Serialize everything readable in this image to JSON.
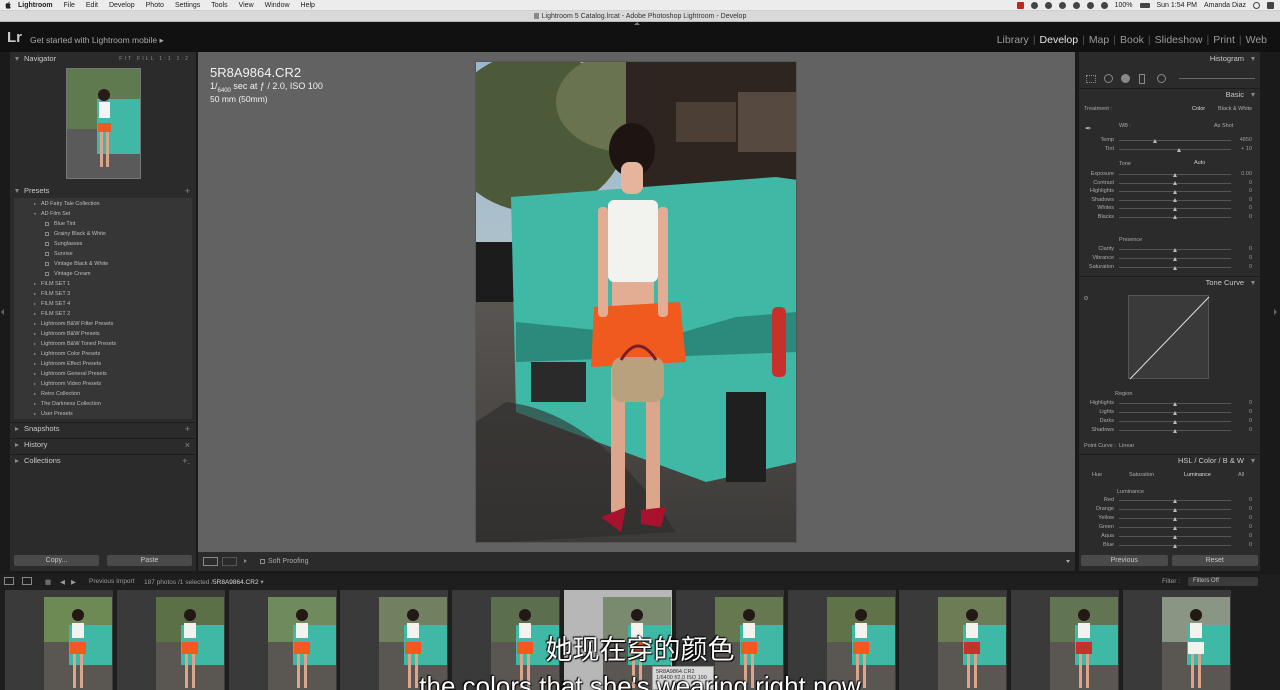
{
  "menubar": {
    "items": [
      "Lightroom",
      "File",
      "Edit",
      "Develop",
      "Photo",
      "Settings",
      "Tools",
      "View",
      "Window",
      "Help"
    ],
    "battery": "100%",
    "clock": "Sun 1:54 PM",
    "user": "Amanda Diaz"
  },
  "window": {
    "title": "Lightroom 5 Catalog.lrcat - Adobe Photoshop Lightroom - Develop"
  },
  "topbar": {
    "logo": "Lr",
    "mobile_prompt": "Get started with Lightroom mobile",
    "modules": [
      "Library",
      "Develop",
      "Map",
      "Book",
      "Slideshow",
      "Print",
      "Web"
    ],
    "active_module": "Develop"
  },
  "left": {
    "navigator": {
      "title": "Navigator",
      "zoom_opts": "FIT FILL 1:1 1:2"
    },
    "presets": {
      "title": "Presets",
      "items": [
        {
          "label": "AD Fairy Tale Collection",
          "level": 1,
          "open": false
        },
        {
          "label": "AD Film Set",
          "level": 1,
          "open": true
        },
        {
          "label": "Blue Tint",
          "level": 2
        },
        {
          "label": "Grainy Black & White",
          "level": 2
        },
        {
          "label": "Sunglasses",
          "level": 2
        },
        {
          "label": "Sunrise",
          "level": 2
        },
        {
          "label": "Vintage Black & White",
          "level": 2
        },
        {
          "label": "Vintage Cream",
          "level": 2
        },
        {
          "label": "FILM SET 1",
          "level": 1,
          "open": false
        },
        {
          "label": "FILM SET 3",
          "level": 1,
          "open": false
        },
        {
          "label": "FILM SET 4",
          "level": 1,
          "open": false
        },
        {
          "label": "FILM SET 2",
          "level": 1,
          "open": false
        },
        {
          "label": "Lightroom B&W Filter Presets",
          "level": 1,
          "open": false
        },
        {
          "label": "Lightroom B&W Presets",
          "level": 1,
          "open": false
        },
        {
          "label": "Lightroom B&W Toned Presets",
          "level": 1,
          "open": false
        },
        {
          "label": "Lightroom Color Presets",
          "level": 1,
          "open": false
        },
        {
          "label": "Lightroom Effect Presets",
          "level": 1,
          "open": false
        },
        {
          "label": "Lightroom General Presets",
          "level": 1,
          "open": false
        },
        {
          "label": "Lightroom Video Presets",
          "level": 1,
          "open": false
        },
        {
          "label": "Retro Collection",
          "level": 1,
          "open": false
        },
        {
          "label": "The Darkness Collection",
          "level": 1,
          "open": false
        },
        {
          "label": "User Presets",
          "level": 1,
          "open": false
        }
      ]
    },
    "snapshots": "Snapshots",
    "history": "History",
    "collections": "Collections",
    "copy_btn": "Copy...",
    "paste_btn": "Paste"
  },
  "photo": {
    "filename": "5R8A9864.CR2",
    "exposure_pre": "1/",
    "exposure_den": "6400",
    "exposure_post": " sec at ƒ / 2.0, ISO 100",
    "lens": "50 mm (50mm)"
  },
  "toolbar": {
    "soft_proofing": "Soft Proofing"
  },
  "right": {
    "histogram": "Histogram",
    "basic": "Basic",
    "treatment": "Treatment :",
    "color": "Color",
    "bw": "Black & White",
    "wb": "WB :",
    "wb_value": "As Shot",
    "tone": "Tone",
    "auto": "Auto",
    "presence": "Presence",
    "tone_curve": "Tone Curve",
    "region": "Region",
    "point_curve": "Point Curve :",
    "point_curve_value": "Linear",
    "hsl_header": "HSL",
    "color_header": "Color",
    "bw_header": "B & W",
    "hsl_tabs": [
      "Hue",
      "Saturation",
      "Luminance",
      "All"
    ],
    "luminance": "Luminance",
    "previous_btn": "Previous",
    "reset_btn": "Reset",
    "basic_sliders": [
      {
        "label": "Temp",
        "value": "4850",
        "pos": 0.32
      },
      {
        "label": "Tint",
        "value": "+ 10",
        "pos": 0.54
      }
    ],
    "tone_sliders": [
      {
        "label": "Exposure",
        "value": "0.00",
        "pos": 0.5
      },
      {
        "label": "Contrast",
        "value": "0",
        "pos": 0.5
      },
      {
        "label": "Highlights",
        "value": "0",
        "pos": 0.5
      },
      {
        "label": "Shadows",
        "value": "0",
        "pos": 0.5
      },
      {
        "label": "Whites",
        "value": "0",
        "pos": 0.5
      },
      {
        "label": "Blacks",
        "value": "0",
        "pos": 0.5
      }
    ],
    "presence_sliders": [
      {
        "label": "Clarity",
        "value": "0",
        "pos": 0.5
      },
      {
        "label": "Vibrance",
        "value": "0",
        "pos": 0.5
      },
      {
        "label": "Saturation",
        "value": "0",
        "pos": 0.5
      }
    ],
    "region_sliders": [
      {
        "label": "Highlights",
        "value": "0",
        "pos": 0.5
      },
      {
        "label": "Lights",
        "value": "0",
        "pos": 0.5
      },
      {
        "label": "Darks",
        "value": "0",
        "pos": 0.5
      },
      {
        "label": "Shadows",
        "value": "0",
        "pos": 0.5
      }
    ],
    "lum_sliders": [
      {
        "label": "Red",
        "value": "0",
        "pos": 0.5
      },
      {
        "label": "Orange",
        "value": "0",
        "pos": 0.5
      },
      {
        "label": "Yellow",
        "value": "0",
        "pos": 0.5
      },
      {
        "label": "Green",
        "value": "0",
        "pos": 0.5
      },
      {
        "label": "Aqua",
        "value": "0",
        "pos": 0.5
      },
      {
        "label": "Blue",
        "value": "0",
        "pos": 0.5
      }
    ]
  },
  "filmstrip": {
    "source": "Previous Import",
    "count_prefix": "187 photos /1 selected /",
    "selected_file": "5R8A9864.CR2",
    "filter_label": "Filter :",
    "filter_value": "Filters Off",
    "hover_file": "5R8A9864.CR2",
    "hover_meta": "1/6400 f/2.0 ISO 100",
    "thumb_count": 11,
    "selected_index": 5
  },
  "subtitles": {
    "cn": "她现在穿的颜色",
    "en": "the colors that she's wearing right now"
  },
  "colors": {
    "accent_red": "#c0261b",
    "truck_teal": "#3fb8a5",
    "shorts_orange": "#f05a1e"
  }
}
